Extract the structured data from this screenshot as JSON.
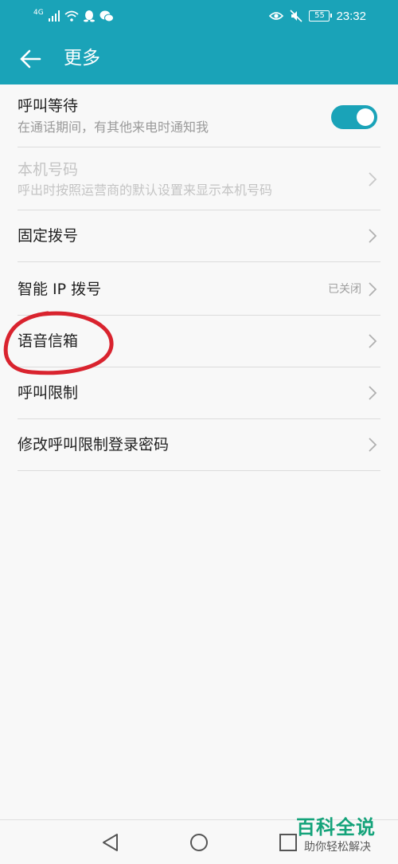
{
  "status_bar": {
    "network": "4G",
    "battery": "55",
    "time": "23:32",
    "icons": [
      "signal-icon",
      "wifi-icon",
      "qq-icon",
      "wechat-icon",
      "eye-icon",
      "mute-icon"
    ]
  },
  "toolbar": {
    "title": "更多",
    "back_icon": "arrow-left-icon"
  },
  "settings": {
    "call_waiting": {
      "title": "呼叫等待",
      "subtitle": "在通话期间，有其他来电时通知我",
      "toggle_on": true
    },
    "caller_id": {
      "title": "本机号码",
      "subtitle": "呼出时按照运营商的默认设置来显示本机号码"
    },
    "fixed_dialing": {
      "title": "固定拨号"
    },
    "smart_ip": {
      "title": "智能 IP 拨号",
      "value": "已关闭"
    },
    "voicemail": {
      "title": "语音信箱"
    },
    "call_barring": {
      "title": "呼叫限制"
    },
    "barring_password": {
      "title": "修改呼叫限制登录密码"
    }
  },
  "colors": {
    "accent": "#1aa3b8",
    "annotation": "#d9232e",
    "watermark": "#14a37a"
  },
  "watermark": {
    "main": "百科全说",
    "sub": "助你轻松解决"
  }
}
